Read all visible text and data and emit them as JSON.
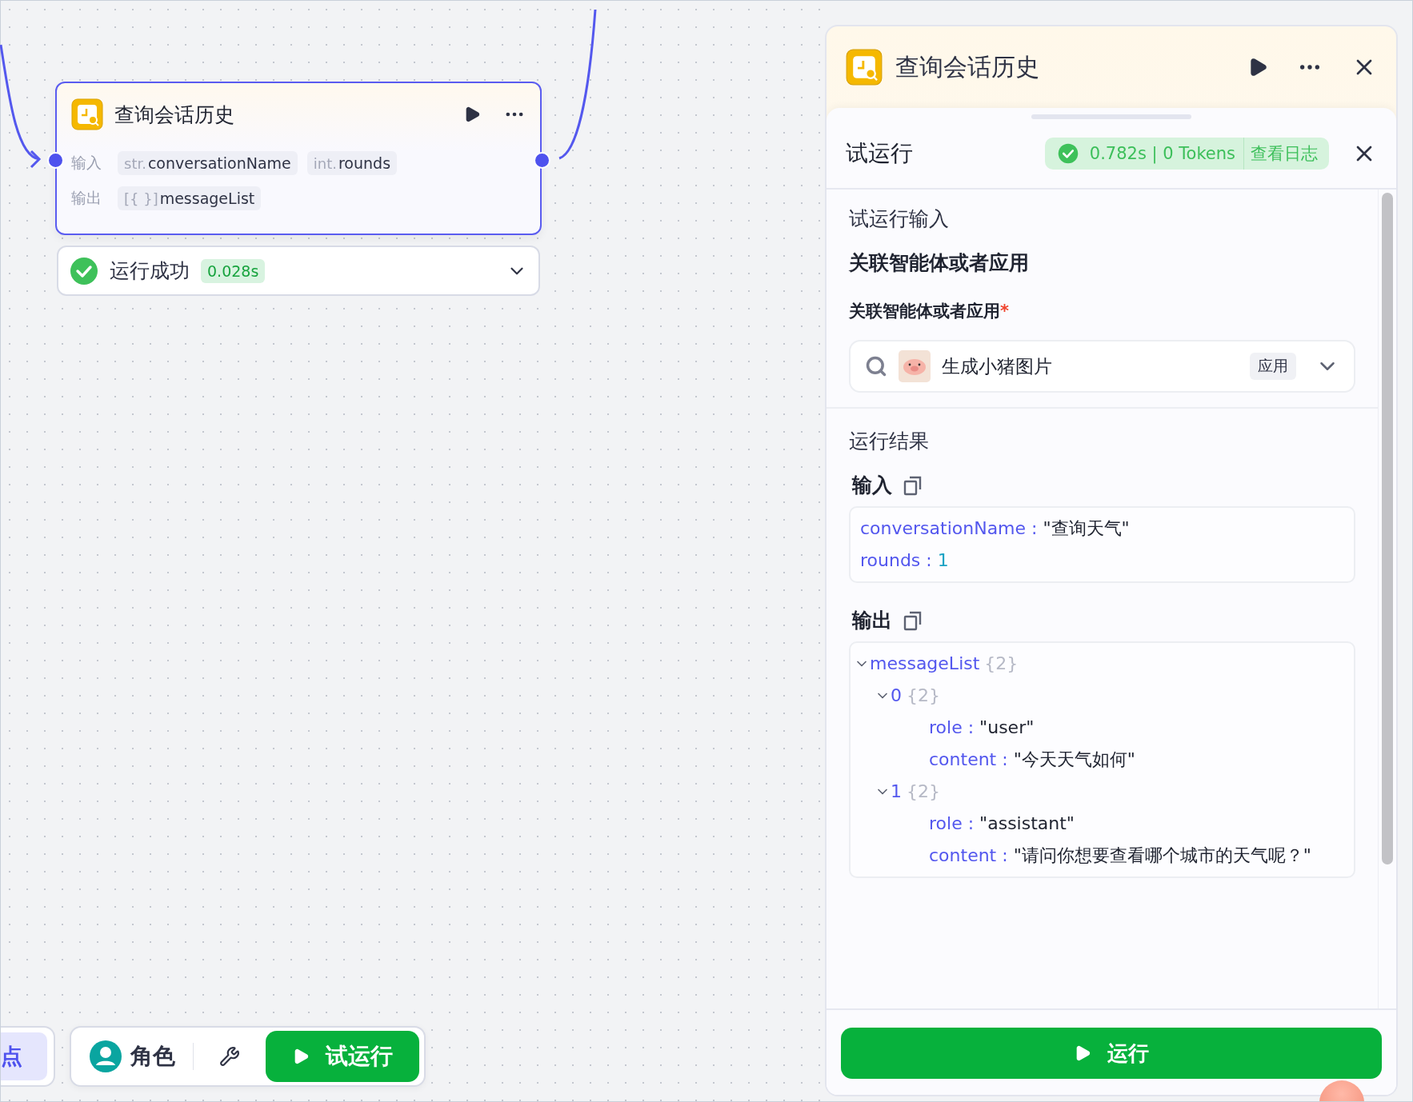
{
  "canvas": {
    "node": {
      "title": "查询会话历史",
      "inputs_label": "输入",
      "inputs": [
        {
          "type": "str.",
          "name": "conversationName"
        },
        {
          "type": "int.",
          "name": "rounds"
        }
      ],
      "outputs_label": "输出",
      "outputs": [
        {
          "type": "[{ }]",
          "name": "messageList"
        }
      ]
    },
    "run_status": {
      "label": "运行成功",
      "time": "0.028s",
      "expanded": false
    }
  },
  "toolbar": {
    "partial_button": "点",
    "role_button": "角色",
    "test_run_button": "试运行"
  },
  "panel": {
    "title": "查询会话历史",
    "test_run": {
      "title": "试运行",
      "stats": "0.782s | 0 Tokens",
      "log_link": "查看日志"
    },
    "input_section": {
      "heading": "试运行输入",
      "group_title": "关联智能体或者应用",
      "field_label": "关联智能体或者应用",
      "required": true,
      "required_mark": "*",
      "select": {
        "value": "生成小猪图片",
        "tag": "应用"
      }
    },
    "results": {
      "heading": "运行结果",
      "separator": " : ",
      "input": {
        "label": "输入",
        "entries": [
          {
            "key": "conversationName",
            "value": "\"查询天气\"",
            "kind": "string"
          },
          {
            "key": "rounds",
            "value": "1",
            "kind": "number"
          }
        ]
      },
      "output": {
        "label": "输出",
        "tree": [
          {
            "key": "messageList",
            "count": "{2}",
            "expanded": true,
            "children": [
              {
                "key": "0",
                "count": "{2}",
                "expanded": true,
                "children": [
                  {
                    "key": "role",
                    "value": "\"user\""
                  },
                  {
                    "key": "content",
                    "value": "\"今天天气如何\""
                  }
                ]
              },
              {
                "key": "1",
                "count": "{2}",
                "expanded": true,
                "children": [
                  {
                    "key": "role",
                    "value": "\"assistant\""
                  },
                  {
                    "key": "content",
                    "value": "\"请问你想要查看哪个城市的天气呢？\""
                  }
                ]
              }
            ]
          }
        ]
      }
    },
    "run_button": "运行"
  }
}
